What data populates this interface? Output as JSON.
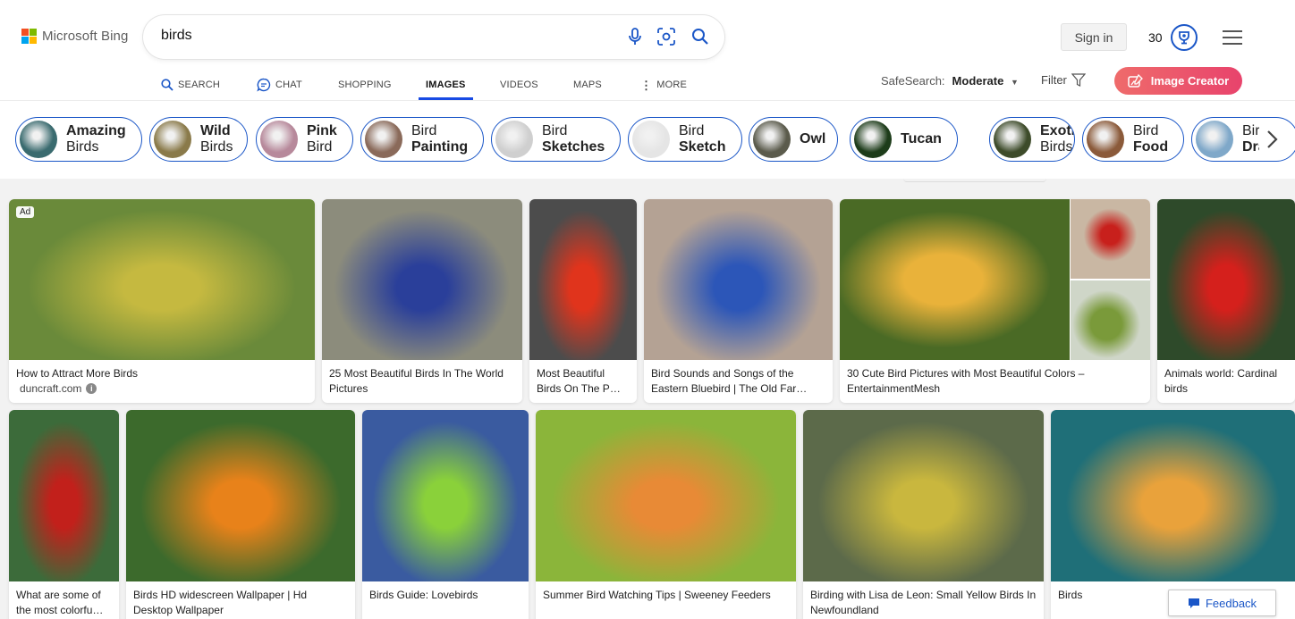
{
  "brand": {
    "name": "Microsoft Bing",
    "colors": [
      "#f25022",
      "#7fba00",
      "#00a4ef",
      "#ffb900"
    ]
  },
  "search": {
    "query": "birds",
    "mic_icon": "microphone-icon",
    "visual_icon": "visual-search-icon",
    "search_icon": "search-icon"
  },
  "header": {
    "sign_in": "Sign in",
    "points": "30",
    "rewards_icon": "rewards-trophy-icon",
    "menu_icon": "hamburger-menu-icon"
  },
  "tabs": [
    {
      "label": "SEARCH",
      "icon": "search-icon"
    },
    {
      "label": "CHAT",
      "icon": "chat-icon"
    },
    {
      "label": "SHOPPING"
    },
    {
      "label": "IMAGES",
      "active": true
    },
    {
      "label": "VIDEOS"
    },
    {
      "label": "MAPS"
    },
    {
      "label": "MORE",
      "icon": "more-dots-icon"
    }
  ],
  "toolbar": {
    "safesearch_label": "SafeSearch:",
    "safesearch_value": "Moderate",
    "filter_label": "Filter",
    "image_creator": "Image Creator",
    "accent": "#174ae4"
  },
  "chips": [
    {
      "l1": "Amazing",
      "l2": "Birds",
      "bold": "l1",
      "thumb": "#3a6b6f"
    },
    {
      "l1": "Wild",
      "l2": "Birds",
      "bold": "l1",
      "thumb": "#8a7a4a"
    },
    {
      "l1": "Pink",
      "l2": "Bird",
      "bold": "l1",
      "thumb": "#b7899b"
    },
    {
      "l1": "Bird",
      "l2": "Painting",
      "bold": "l2",
      "thumb": "#8a6a5a"
    },
    {
      "l1": "Bird",
      "l2": "Sketches",
      "bold": "l2",
      "thumb": "#cfcfcf"
    },
    {
      "l1": "Bird",
      "l2": "Sketch",
      "bold": "l2",
      "thumb": "#e5e5e5"
    },
    {
      "l1": "Owl",
      "l2": "",
      "bold": "l1",
      "thumb": "#5b5b4c"
    },
    {
      "l1": "Tucan",
      "l2": "",
      "bold": "l1",
      "thumb": "#1d3c1a"
    },
    {
      "l1": "Exotic",
      "l2": "Birds",
      "bold": "l1",
      "thumb": "#3d4b2a"
    },
    {
      "l1": "Bird",
      "l2": "Food",
      "bold": "l2",
      "thumb": "#8b5a3a"
    },
    {
      "l1": "Bir",
      "l2": "Dra",
      "bold": "l2",
      "thumb": "#7fa8c9"
    }
  ],
  "results_row1": [
    {
      "caption": "How to Attract More Birds",
      "source": "duncraft.com",
      "ad": "Ad",
      "colors": [
        "#6a8a3a",
        "#c5b940"
      ]
    },
    {
      "caption": "25 Most Beautiful Birds In The World Pictures",
      "colors": [
        "#8c8c7c",
        "#2a3f9a"
      ]
    },
    {
      "caption": "Most Beautiful Birds On The P…",
      "colors": [
        "#4c4c4c",
        "#e0341c"
      ]
    },
    {
      "caption": "Bird Sounds and Songs of the Eastern Bluebird | The Old Far…",
      "colors": [
        "#b4a294",
        "#2c56b8"
      ]
    },
    {
      "caption": "30 Cute Bird Pictures with Most Beautiful Colors – EntertainmentMesh",
      "colors": [
        "#4a6a25",
        "#e9b23a"
      ]
    },
    {
      "caption": "Animals world: Cardinal birds",
      "colors": [
        "#2e4a2a",
        "#d5201c"
      ]
    }
  ],
  "results_row2": [
    {
      "caption": "What are some of the most colorfu…",
      "colors": [
        "#3c6b3a",
        "#c2201b"
      ]
    },
    {
      "caption": "Birds HD widescreen Wallpaper | Hd Desktop Wallpaper",
      "colors": [
        "#3c6a2c",
        "#e8821a"
      ]
    },
    {
      "caption": "Birds Guide: Lovebirds",
      "colors": [
        "#3a5ba0",
        "#8ad13a"
      ]
    },
    {
      "caption": "Summer Bird Watching Tips | Sweeney Feeders",
      "colors": [
        "#8bb53a",
        "#e88a36"
      ]
    },
    {
      "caption": "Birding with Lisa de Leon: Small Yellow Birds In Newfoundland",
      "colors": [
        "#5c6a4a",
        "#c9b73e"
      ]
    },
    {
      "caption": "Birds",
      "colors": [
        "#1f6f78",
        "#e9a23b"
      ]
    }
  ],
  "feedback": "Feedback"
}
